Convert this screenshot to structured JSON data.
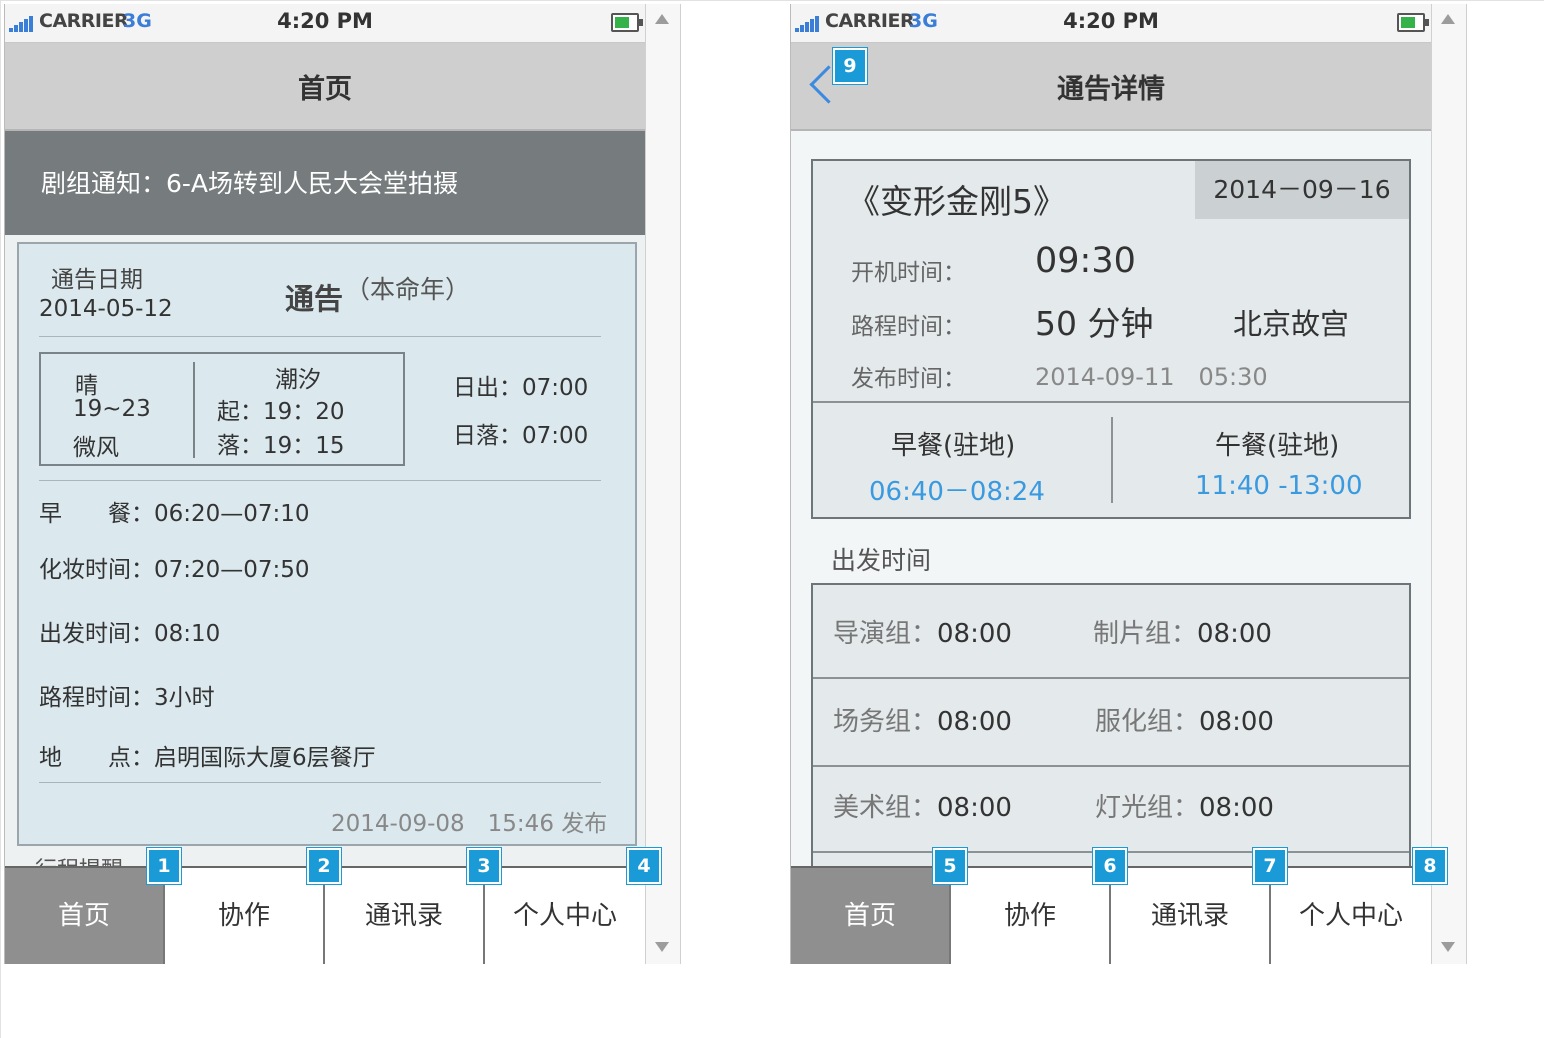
{
  "status_bar": {
    "carrier": "CARRIER",
    "network": "3G",
    "time": "4:20 PM"
  },
  "screen_home": {
    "title": "首页",
    "notice": "剧组通知：6-A场转到人民大会堂拍摄",
    "card": {
      "date_label": "通告日期",
      "date_value": "2014-05-12",
      "heading": "通告",
      "heading_sub": "（本命年）",
      "weather": {
        "condition": "晴",
        "temp": "19~23",
        "wind": "微风"
      },
      "tide": {
        "label": "潮汐",
        "rise": "起：19：20",
        "fall": "落：19：15"
      },
      "sunrise": "日出：07:00",
      "sunset": "日落：07:00",
      "rows": [
        {
          "label": "早　　餐：",
          "value": "06:20—07:10"
        },
        {
          "label": "化妆时间：",
          "value": "07:20—07:50"
        },
        {
          "label": "出发时间：",
          "value": "08:10"
        },
        {
          "label": "路程时间：",
          "value": "3小时"
        },
        {
          "label": "地　　点：",
          "value": "启明国际大厦6层餐厅"
        }
      ],
      "published": "2014-09-08　15:46 发布"
    },
    "peek_text": "行程提醒"
  },
  "screen_detail": {
    "title": "通告详情",
    "movie": "《变形金刚5》",
    "date": "2014－09－16",
    "start_label": "开机时间：",
    "start_value": "09:30",
    "route_label": "路程时间：",
    "route_value": "50 分钟",
    "location": "北京故宫",
    "publish_label": "发布时间：",
    "publish_value": "2014-09-11　05:30",
    "meals": [
      {
        "name": "早餐(驻地)",
        "time": "06:40－08:24"
      },
      {
        "name": "午餐(驻地)",
        "time": "11:40 -13:00"
      }
    ],
    "depart_heading": "出发时间",
    "groups": [
      {
        "left_label": "导演组：",
        "left_time": "08:00",
        "right_label": "制片组：",
        "right_time": "08:00"
      },
      {
        "left_label": "场务组：",
        "left_time": "08:00",
        "right_label": "服化组：",
        "right_time": "08:00"
      },
      {
        "left_label": "美术组：",
        "left_time": "08:00",
        "right_label": "灯光组：",
        "right_time": "08:00"
      }
    ]
  },
  "tabbar": {
    "tabs": [
      "首页",
      "协作",
      "通讯录",
      "个人中心"
    ]
  },
  "badges": {
    "home": [
      "1",
      "2",
      "3",
      "4"
    ],
    "detail": [
      "5",
      "6",
      "7",
      "8"
    ],
    "back": "9"
  },
  "colors": {
    "accent_blue": "#3a9ae0",
    "badge_blue": "#1a9ad6",
    "active_tab": "#8f8f8f",
    "banner": "#767c7d"
  }
}
